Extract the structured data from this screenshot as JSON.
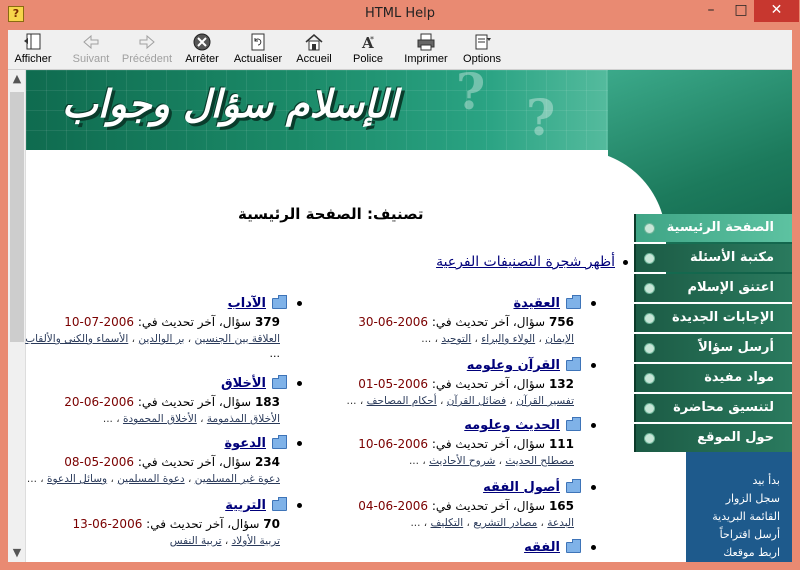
{
  "window": {
    "title": "HTML Help",
    "min": "–",
    "max": "□",
    "close": "✕"
  },
  "toolbar": [
    {
      "id": "afficher",
      "label": "Afficher",
      "icon": "show-pane-icon",
      "enabled": true
    },
    {
      "id": "suivant",
      "label": "Suivant",
      "icon": "back-arrow-icon",
      "enabled": false
    },
    {
      "id": "precedent",
      "label": "Précédent",
      "icon": "forward-arrow-icon",
      "enabled": false
    },
    {
      "id": "arreter",
      "label": "Arrêter",
      "icon": "stop-icon",
      "enabled": true
    },
    {
      "id": "actualiser",
      "label": "Actualiser",
      "icon": "refresh-icon",
      "enabled": true
    },
    {
      "id": "accueil",
      "label": "Accueil",
      "icon": "home-icon",
      "enabled": true
    },
    {
      "id": "police",
      "label": "Police",
      "icon": "font-icon",
      "enabled": true
    },
    {
      "id": "imprimer",
      "label": "Imprimer",
      "icon": "print-icon",
      "enabled": true
    },
    {
      "id": "options",
      "label": "Options",
      "icon": "options-icon",
      "enabled": true
    }
  ],
  "banner": {
    "logo": "الإسلام سؤال وجواب"
  },
  "page": {
    "heading": "تصنيف: الصفحة الرئيسية",
    "tree_link": "أظهر شجرة التصنيفات الفرعية"
  },
  "categories_right": [
    {
      "title": "العقيدة",
      "count": "756",
      "stats": "سؤال، آخر تحديث في:",
      "date": "2006-06-30",
      "subs": [
        "الإيمان",
        "الولاء والبراء",
        "التوحيد"
      ],
      "more": "..."
    },
    {
      "title": "القرآن وعلومه",
      "count": "132",
      "stats": "سؤال، آخر تحديث في:",
      "date": "2006-05-01",
      "subs": [
        "تفسير القرآن",
        "فضائل القرآن",
        "أحكام المصاحف"
      ],
      "more": "..."
    },
    {
      "title": "الحديث وعلومه",
      "count": "111",
      "stats": "سؤال، آخر تحديث في:",
      "date": "2006-06-10",
      "subs": [
        "مصطلح الحديث",
        "شروح الأحاديث"
      ],
      "more": "..."
    },
    {
      "title": "أصول الفقه",
      "count": "165",
      "stats": "سؤال، آخر تحديث في:",
      "date": "2006-06-04",
      "subs": [
        "البدعة",
        "مصادر التشريع",
        "التكليف"
      ],
      "more": "..."
    },
    {
      "title": "الفقه",
      "count": "",
      "stats": "",
      "date": "",
      "subs": [],
      "more": ""
    }
  ],
  "categories_left": [
    {
      "title": "الآداب",
      "count": "379",
      "stats": "سؤال، آخر تحديث في:",
      "date": "2006-07-10",
      "subs": [
        "العلاقة بين الجنسين",
        "بر الوالدين",
        "الأسماء والكنى والألقاب"
      ],
      "more": "..."
    },
    {
      "title": "الأخلاق",
      "count": "183",
      "stats": "سؤال، آخر تحديث في:",
      "date": "2006-06-20",
      "subs": [
        "الأخلاق المذمومة",
        "الأخلاق المحمودة"
      ],
      "more": "..."
    },
    {
      "title": "الدعوة",
      "count": "234",
      "stats": "سؤال، آخر تحديث في:",
      "date": "2006-05-08",
      "subs": [
        "دعوة غير المسلمين",
        "دعوة المسلمين",
        "وسائل الدعوة"
      ],
      "more": "..."
    },
    {
      "title": "التربية",
      "count": "70",
      "stats": "سؤال، آخر تحديث في:",
      "date": "2006-06-13",
      "subs": [
        "تربية الأولاد",
        "تربية النفس"
      ],
      "more": "..."
    }
  ],
  "sidenav": [
    {
      "label": "الصفحة الرئيسية",
      "active": true
    },
    {
      "label": "مكتبة الأسئلة",
      "active": false
    },
    {
      "label": "اعتنق الإسلام",
      "active": false
    },
    {
      "label": "الإجابات الجديدة",
      "active": false
    },
    {
      "label": "أرسل سؤالاً",
      "active": false
    },
    {
      "label": "مواد مفيدة",
      "active": false
    },
    {
      "label": "لتنسيق محاضرة",
      "active": false
    },
    {
      "label": "حول الموقع",
      "active": false
    }
  ],
  "side_panel": [
    "بدأ بيد",
    "سجل الزوار",
    "القائمة البريدية",
    "أرسل اقتراحاً",
    "اربط موقعك"
  ],
  "colors": {
    "frame": "#e98a72",
    "banner": "#1b8a68",
    "nav": "#2a7a5e",
    "nav_active": "#5dc2a1",
    "side_panel": "#1e5a8c",
    "link": "#00007a",
    "date": "#7a0000"
  }
}
